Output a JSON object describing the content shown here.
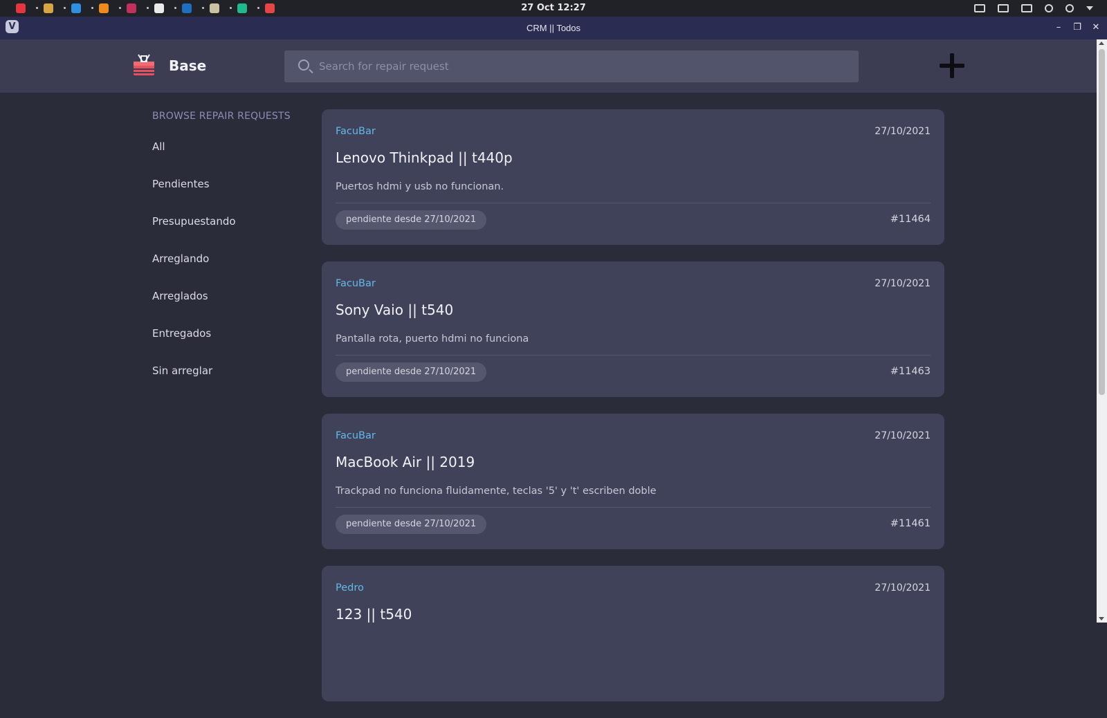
{
  "os": {
    "clock": "27 Oct  12:27",
    "taskbar_apps": [
      {
        "name": "vivaldi-icon",
        "color": "#e5363f"
      },
      {
        "name": "font-manager-icon",
        "color": "#d9a544"
      },
      {
        "name": "vscode-icon",
        "color": "#2f8fe0"
      },
      {
        "name": "vlc-icon",
        "color": "#f08a1c"
      },
      {
        "name": "jetbrains-icon",
        "color": "#c2305c"
      },
      {
        "name": "notion-icon",
        "color": "#eaeaea"
      },
      {
        "name": "steam-icon",
        "color": "#1f6fbf"
      },
      {
        "name": "files-icon",
        "color": "#c9c2a2"
      },
      {
        "name": "openshot-icon",
        "color": "#1fb88f"
      },
      {
        "name": "screen-recorder-icon",
        "color": "#e64545"
      }
    ]
  },
  "window": {
    "title": "CRM || Todos"
  },
  "header": {
    "brand": "Base",
    "search_placeholder": "Search for repair request"
  },
  "sidebar": {
    "title": "BROWSE REPAIR REQUESTS",
    "items": [
      "All",
      "Pendientes",
      "Presupuestando",
      "Arreglando",
      "Arreglados",
      "Entregados",
      "Sin arreglar"
    ]
  },
  "requests": [
    {
      "author": "FacuBar",
      "date": "27/10/2021",
      "title": "Lenovo Thinkpad || t440p",
      "description": "Puertos hdmi y usb no funcionan.",
      "status": "pendiente desde 27/10/2021",
      "number": "#11464"
    },
    {
      "author": "FacuBar",
      "date": "27/10/2021",
      "title": "Sony Vaio || t540",
      "description": "Pantalla rota, puerto hdmi no funciona",
      "status": "pendiente desde 27/10/2021",
      "number": "#11463"
    },
    {
      "author": "FacuBar",
      "date": "27/10/2021",
      "title": "MacBook Air || 2019",
      "description": "Trackpad no funciona fluidamente, teclas '5' y 't' escriben doble",
      "status": "pendiente desde 27/10/2021",
      "number": "#11461"
    },
    {
      "author": "Pedro",
      "date": "27/10/2021",
      "title": "123 || t540",
      "description": "",
      "status": "",
      "number": ""
    }
  ],
  "colors": {
    "accent": "#64b9e8",
    "card_bg": "#40425a",
    "page_bg": "#2b2c3a"
  }
}
